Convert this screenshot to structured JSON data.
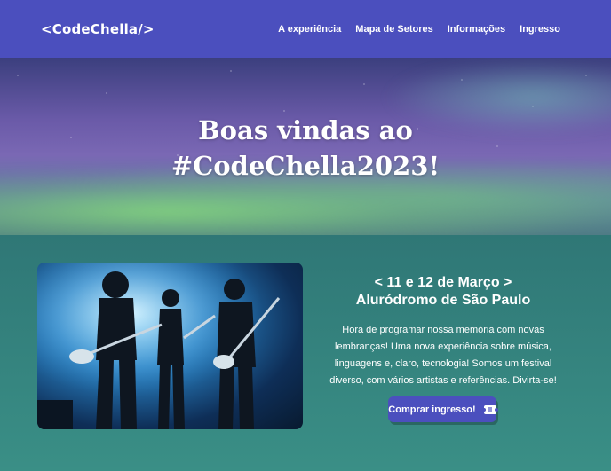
{
  "header": {
    "logo": "<CodeChella/>",
    "nav": [
      {
        "label": "A experiência"
      },
      {
        "label": "Mapa de Setores"
      },
      {
        "label": "Informações"
      },
      {
        "label": "Ingresso"
      }
    ]
  },
  "hero": {
    "title_line1": "Boas vindas ao",
    "title_line2": "#CodeChella2023!"
  },
  "event": {
    "date": "< 11 e 12 de Março >",
    "venue": "Aluródromo de São Paulo",
    "description": "Hora de programar nossa memória com novas lembranças! Uma nova experiência sobre música, linguagens e, claro, tecnologia! Somos um festival diverso, com vários artistas e referências. Divirta-se!",
    "button_label": "Comprar ingresso!"
  },
  "colors": {
    "brand": "#4b4fbe",
    "content_bg": "#2f7b78"
  }
}
